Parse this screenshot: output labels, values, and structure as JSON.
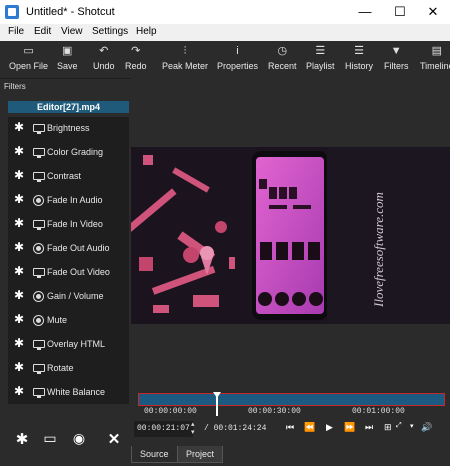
{
  "window": {
    "title": "Untitled* - Shotcut",
    "minimize": "—",
    "maximize": "☐",
    "close": "✕"
  },
  "menu": [
    "File",
    "Edit",
    "View",
    "Settings",
    "Help"
  ],
  "toolbar": [
    {
      "label": "Open File",
      "icon": "folder-icon",
      "glyph": "▭"
    },
    {
      "label": "Save",
      "icon": "save-icon",
      "glyph": "▣"
    },
    {
      "label": "Undo",
      "icon": "undo-icon",
      "glyph": "↶"
    },
    {
      "label": "Redo",
      "icon": "redo-icon",
      "glyph": "↷"
    },
    {
      "label": "Peak Meter",
      "icon": "peak-meter-icon",
      "glyph": "⫶"
    },
    {
      "label": "Properties",
      "icon": "info-icon",
      "glyph": "i"
    },
    {
      "label": "Recent",
      "icon": "clock-icon",
      "glyph": "◷"
    },
    {
      "label": "Playlist",
      "icon": "playlist-icon",
      "glyph": "☰"
    },
    {
      "label": "History",
      "icon": "history-icon",
      "glyph": "☰"
    },
    {
      "label": "Filters",
      "icon": "filter-icon",
      "glyph": "▼"
    },
    {
      "label": "Timeline",
      "icon": "timeline-icon",
      "glyph": "▤"
    }
  ],
  "filters_panel": {
    "header": "Filters",
    "clip_name": "Editor[27].mp4",
    "items": [
      {
        "label": "Brightness",
        "type": "video"
      },
      {
        "label": "Color Grading",
        "type": "video"
      },
      {
        "label": "Contrast",
        "type": "video"
      },
      {
        "label": "Fade In Audio",
        "type": "audio"
      },
      {
        "label": "Fade In Video",
        "type": "video"
      },
      {
        "label": "Fade Out Audio",
        "type": "audio"
      },
      {
        "label": "Fade Out Video",
        "type": "video"
      },
      {
        "label": "Gain / Volume",
        "type": "audio"
      },
      {
        "label": "Mute",
        "type": "audio"
      },
      {
        "label": "Overlay HTML",
        "type": "video"
      },
      {
        "label": "Rotate",
        "type": "video"
      },
      {
        "label": "White Balance",
        "type": "video"
      }
    ],
    "bottom_buttons": [
      {
        "icon": "favorite-asterisk-icon",
        "glyph": "✱"
      },
      {
        "icon": "video-filter-icon",
        "glyph": "▭"
      },
      {
        "icon": "audio-filter-icon",
        "glyph": "◉"
      },
      {
        "icon": "close-icon",
        "glyph": "✕"
      }
    ]
  },
  "preview": {
    "watermark": "Ilovefreesoftware.com"
  },
  "timeline": {
    "ticks": [
      "00:00:00:00",
      "00:00:30:00",
      "00:01:00:00"
    ]
  },
  "transport": {
    "current_time": "00:00:21:07",
    "duration": "/ 00:01:24:24",
    "buttons": [
      "⏮",
      "⏪",
      "▶",
      "⏩",
      "⏭"
    ]
  },
  "tabs": [
    "Source",
    "Project"
  ],
  "colors": {
    "accent": "#1f5a7a",
    "timeline_fill": "#1d5a82",
    "timeline_border": "#c62828"
  }
}
